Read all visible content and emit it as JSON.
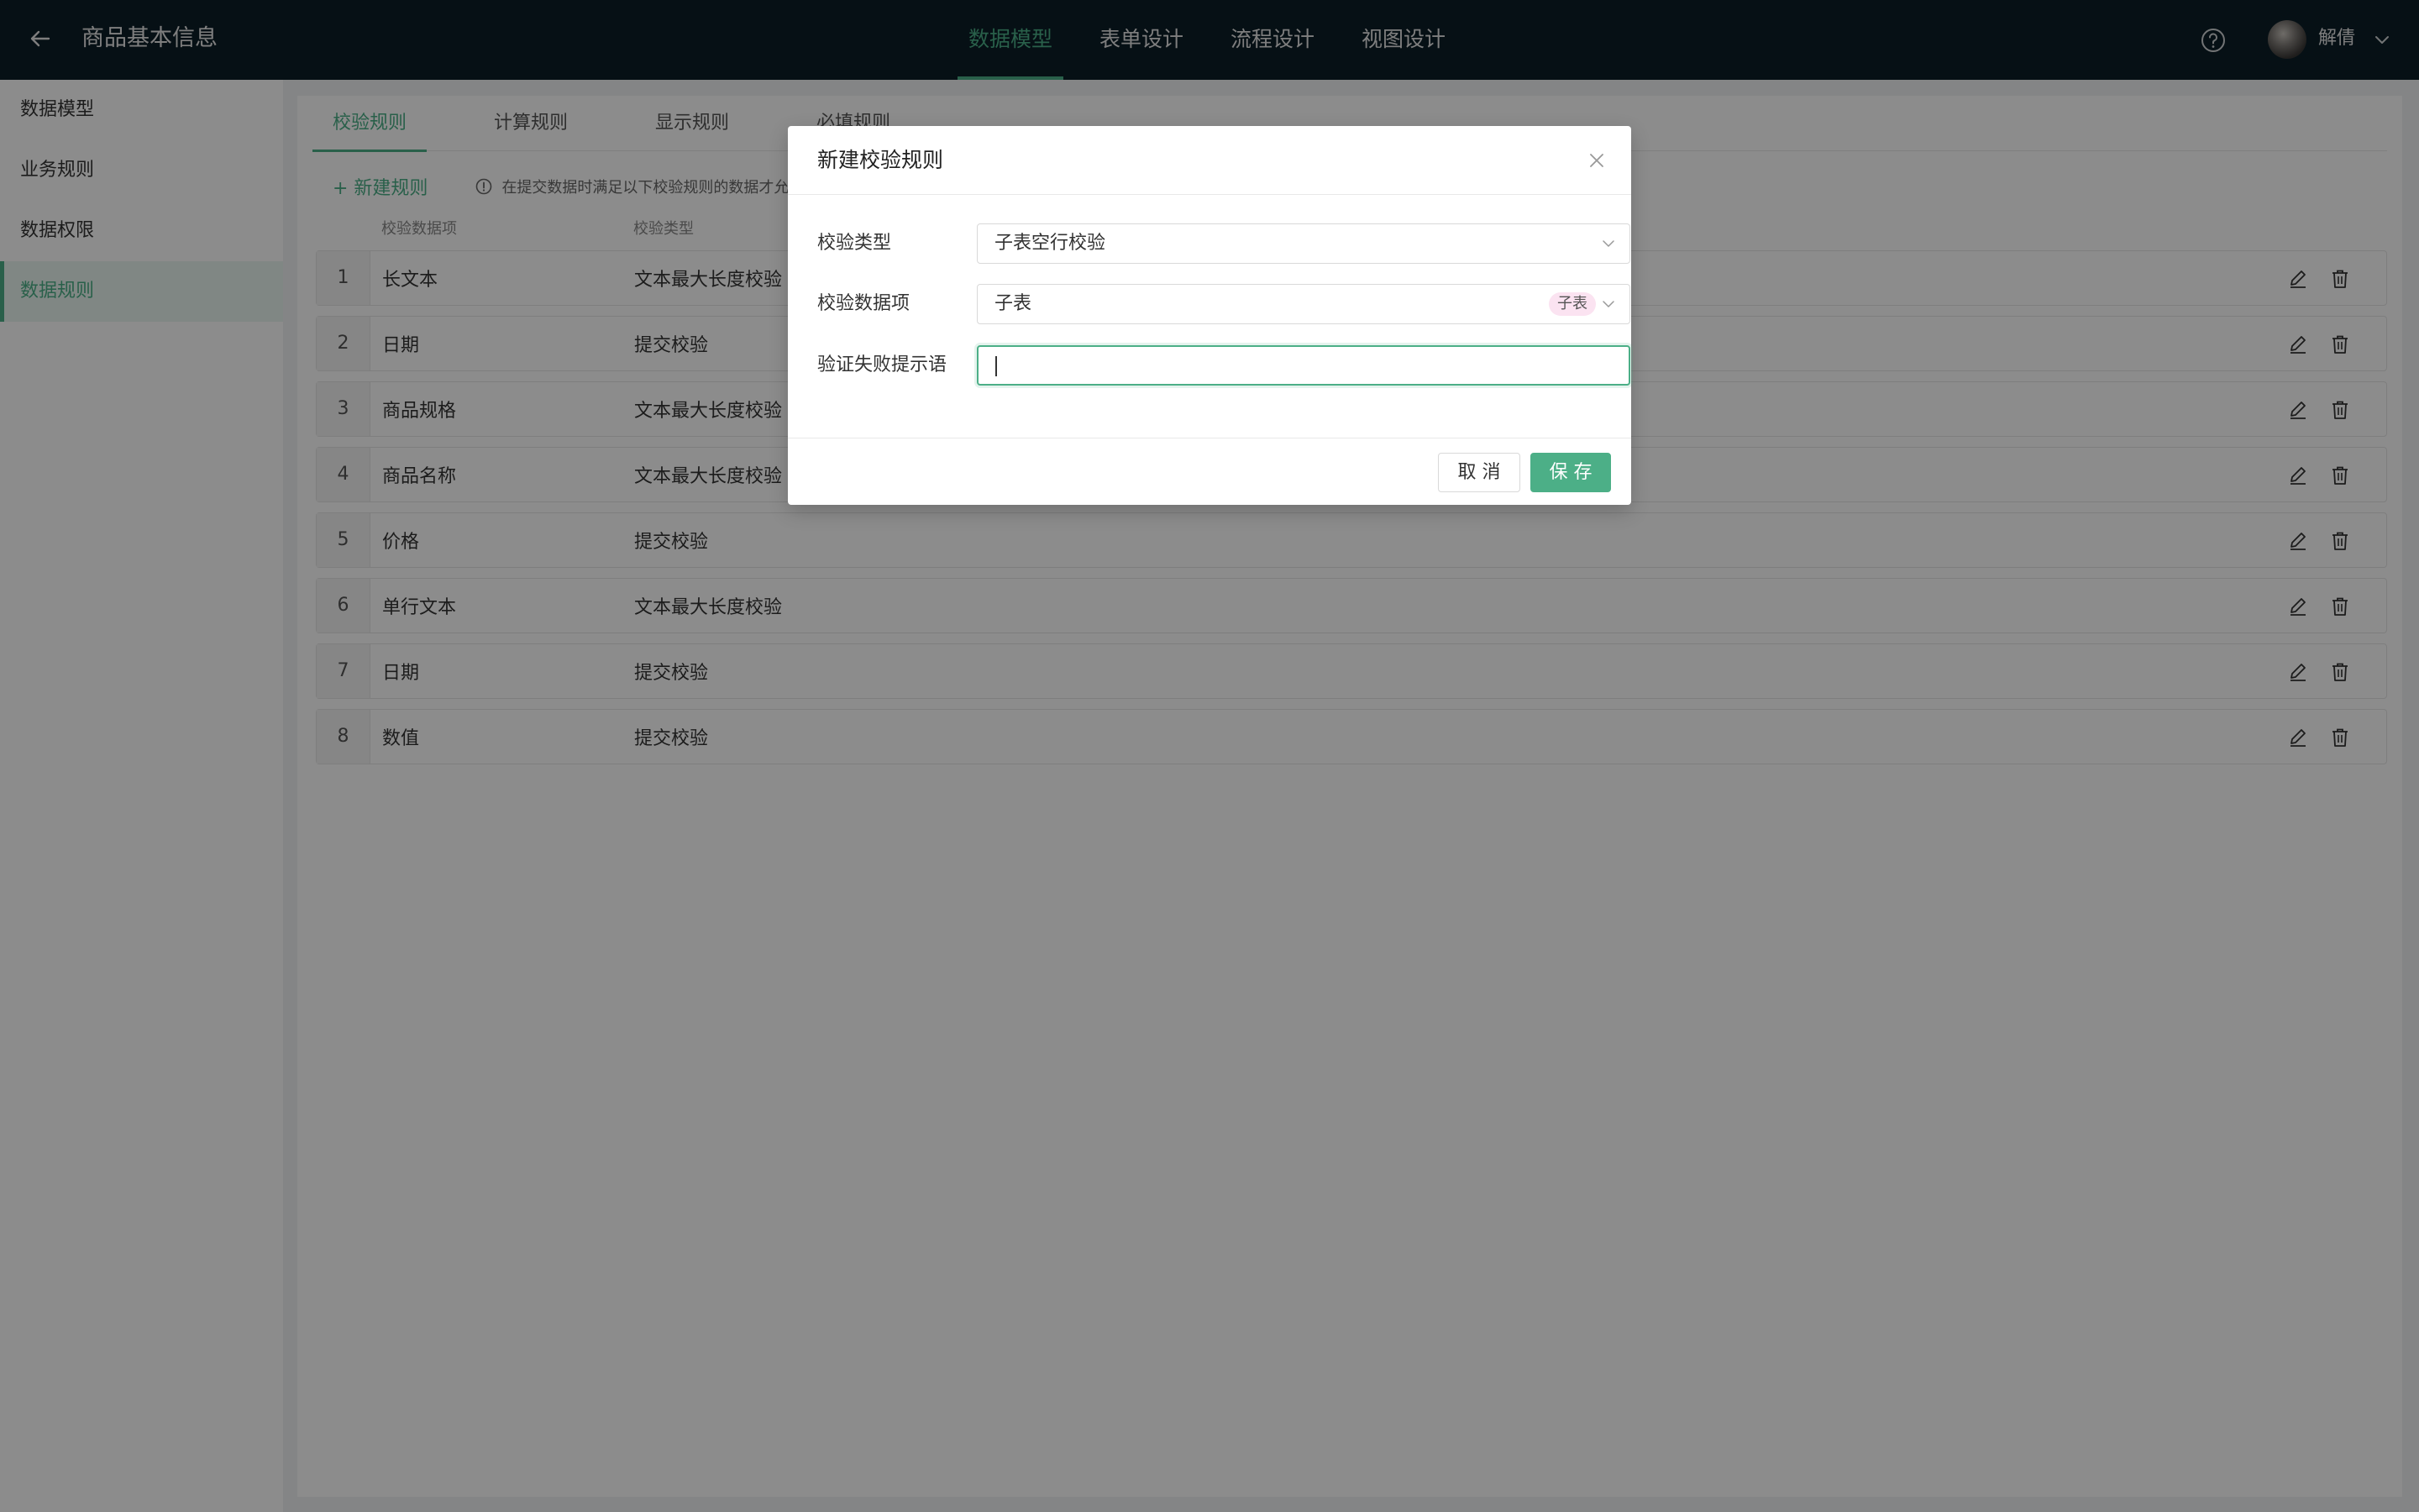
{
  "header": {
    "title": "商品基本信息",
    "nav": [
      "数据模型",
      "表单设计",
      "流程设计",
      "视图设计"
    ],
    "active_nav": 0,
    "username": "解倩"
  },
  "sidebar": {
    "items": [
      {
        "label": "数据模型"
      },
      {
        "label": "业务规则"
      },
      {
        "label": "数据权限"
      },
      {
        "label": "数据规则"
      }
    ],
    "active": 3
  },
  "main": {
    "tabs": [
      {
        "label": "校验规则"
      },
      {
        "label": "计算规则"
      },
      {
        "label": "显示规则"
      },
      {
        "label": "必填规则"
      }
    ],
    "active_tab": 0,
    "new_rule_label": "+ 新建规则",
    "hint": "在提交数据时满足以下校验规则的数据才允许",
    "columns": {
      "field": "校验数据项",
      "type": "校验类型"
    },
    "rows": [
      {
        "index": "1",
        "field": "长文本",
        "type": "文本最大长度校验"
      },
      {
        "index": "2",
        "field": "日期",
        "type": "提交校验"
      },
      {
        "index": "3",
        "field": "商品规格",
        "type": "文本最大长度校验"
      },
      {
        "index": "4",
        "field": "商品名称",
        "type": "文本最大长度校验"
      },
      {
        "index": "5",
        "field": "价格",
        "type": "提交校验"
      },
      {
        "index": "6",
        "field": "单行文本",
        "type": "文本最大长度校验"
      },
      {
        "index": "7",
        "field": "日期",
        "type": "提交校验"
      },
      {
        "index": "8",
        "field": "数值",
        "type": "提交校验"
      }
    ]
  },
  "modal": {
    "title": "新建校验规则",
    "fields": {
      "type_label": "校验类型",
      "type_value": "子表空行校验",
      "item_label": "校验数据项",
      "item_value": "子表",
      "item_tag": "子表",
      "message_label": "验证失败提示语",
      "message_value": ""
    },
    "cancel_label": "取 消",
    "save_label": "保 存"
  },
  "colors": {
    "accent": "#4caf87",
    "topbar": "#0c1e27",
    "tag_bg": "#fbe3f1"
  }
}
